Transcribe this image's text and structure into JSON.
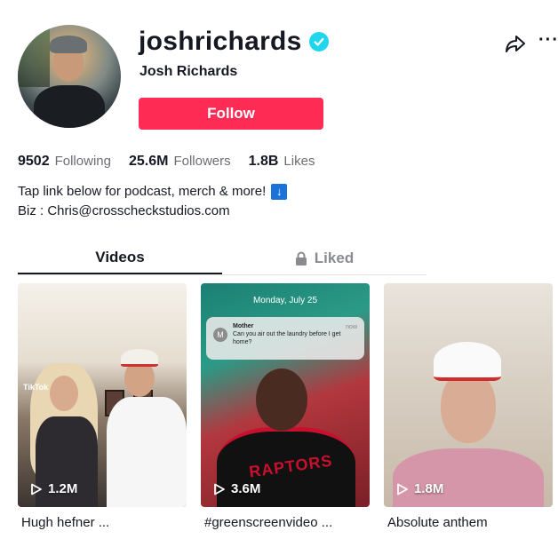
{
  "profile": {
    "username": "joshrichards",
    "nickname": "Josh Richards",
    "follow_label": "Follow"
  },
  "stats": [
    {
      "value": "9502",
      "label": "Following"
    },
    {
      "value": "25.6M",
      "label": "Followers"
    },
    {
      "value": "1.8B",
      "label": "Likes"
    }
  ],
  "bio": {
    "line1": "Tap link below for podcast, merch & more!",
    "line2": "Biz : Chris@crosscheckstudios.com"
  },
  "tabs": {
    "videos": "Videos",
    "liked": "Liked"
  },
  "videos": [
    {
      "views": "1.2M",
      "caption": "Hugh hefner ..."
    },
    {
      "views": "3.6M",
      "caption": "#greenscreenvideo ..."
    },
    {
      "views": "1.8M",
      "caption": "Absolute anthem"
    }
  ],
  "thumb2": {
    "date": "Monday, July 25",
    "notif_from": "Mother",
    "notif_text": "Can you air out the laundry before I get home?",
    "notif_time": "now",
    "jersey": "RAPTORS"
  },
  "thumb1": {
    "watermark": "TikTok"
  },
  "icons": {
    "verified": "verified-badge-icon",
    "share": "share-icon",
    "more": "more-icon",
    "lock": "lock-icon",
    "play": "play-icon",
    "down": "down-arrow-icon"
  },
  "colors": {
    "follow": "#fe2c55",
    "verified": "#20d5ec"
  }
}
